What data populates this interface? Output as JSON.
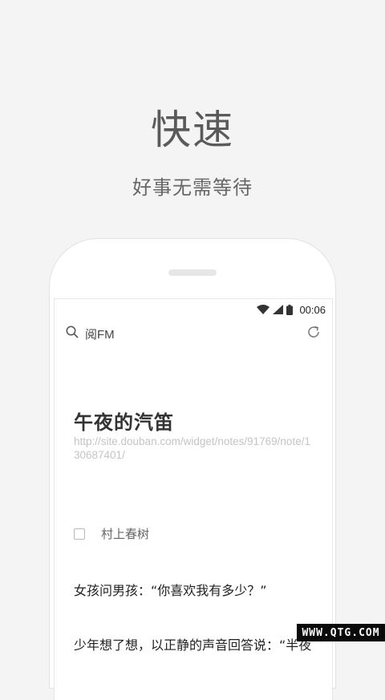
{
  "promo": {
    "headline": "快速",
    "subline": "好事无需等待"
  },
  "status": {
    "time": "00:06",
    "icons": [
      "wifi-icon",
      "signal-icon",
      "battery-icon"
    ]
  },
  "search": {
    "query": "阅FM",
    "icon": "search-icon",
    "refresh_icon": "refresh-icon"
  },
  "article": {
    "title": "午夜的汽笛",
    "url": "http://site.douban.com/widget/notes/91769/note/130687401/",
    "author": "村上春树",
    "paragraph1": "女孩问男孩：“你喜欢我有多少？”",
    "paragraph2": "少年想了想，以正静的声音回答说：“半夜"
  },
  "watermark": "WWW.QTG.COM"
}
